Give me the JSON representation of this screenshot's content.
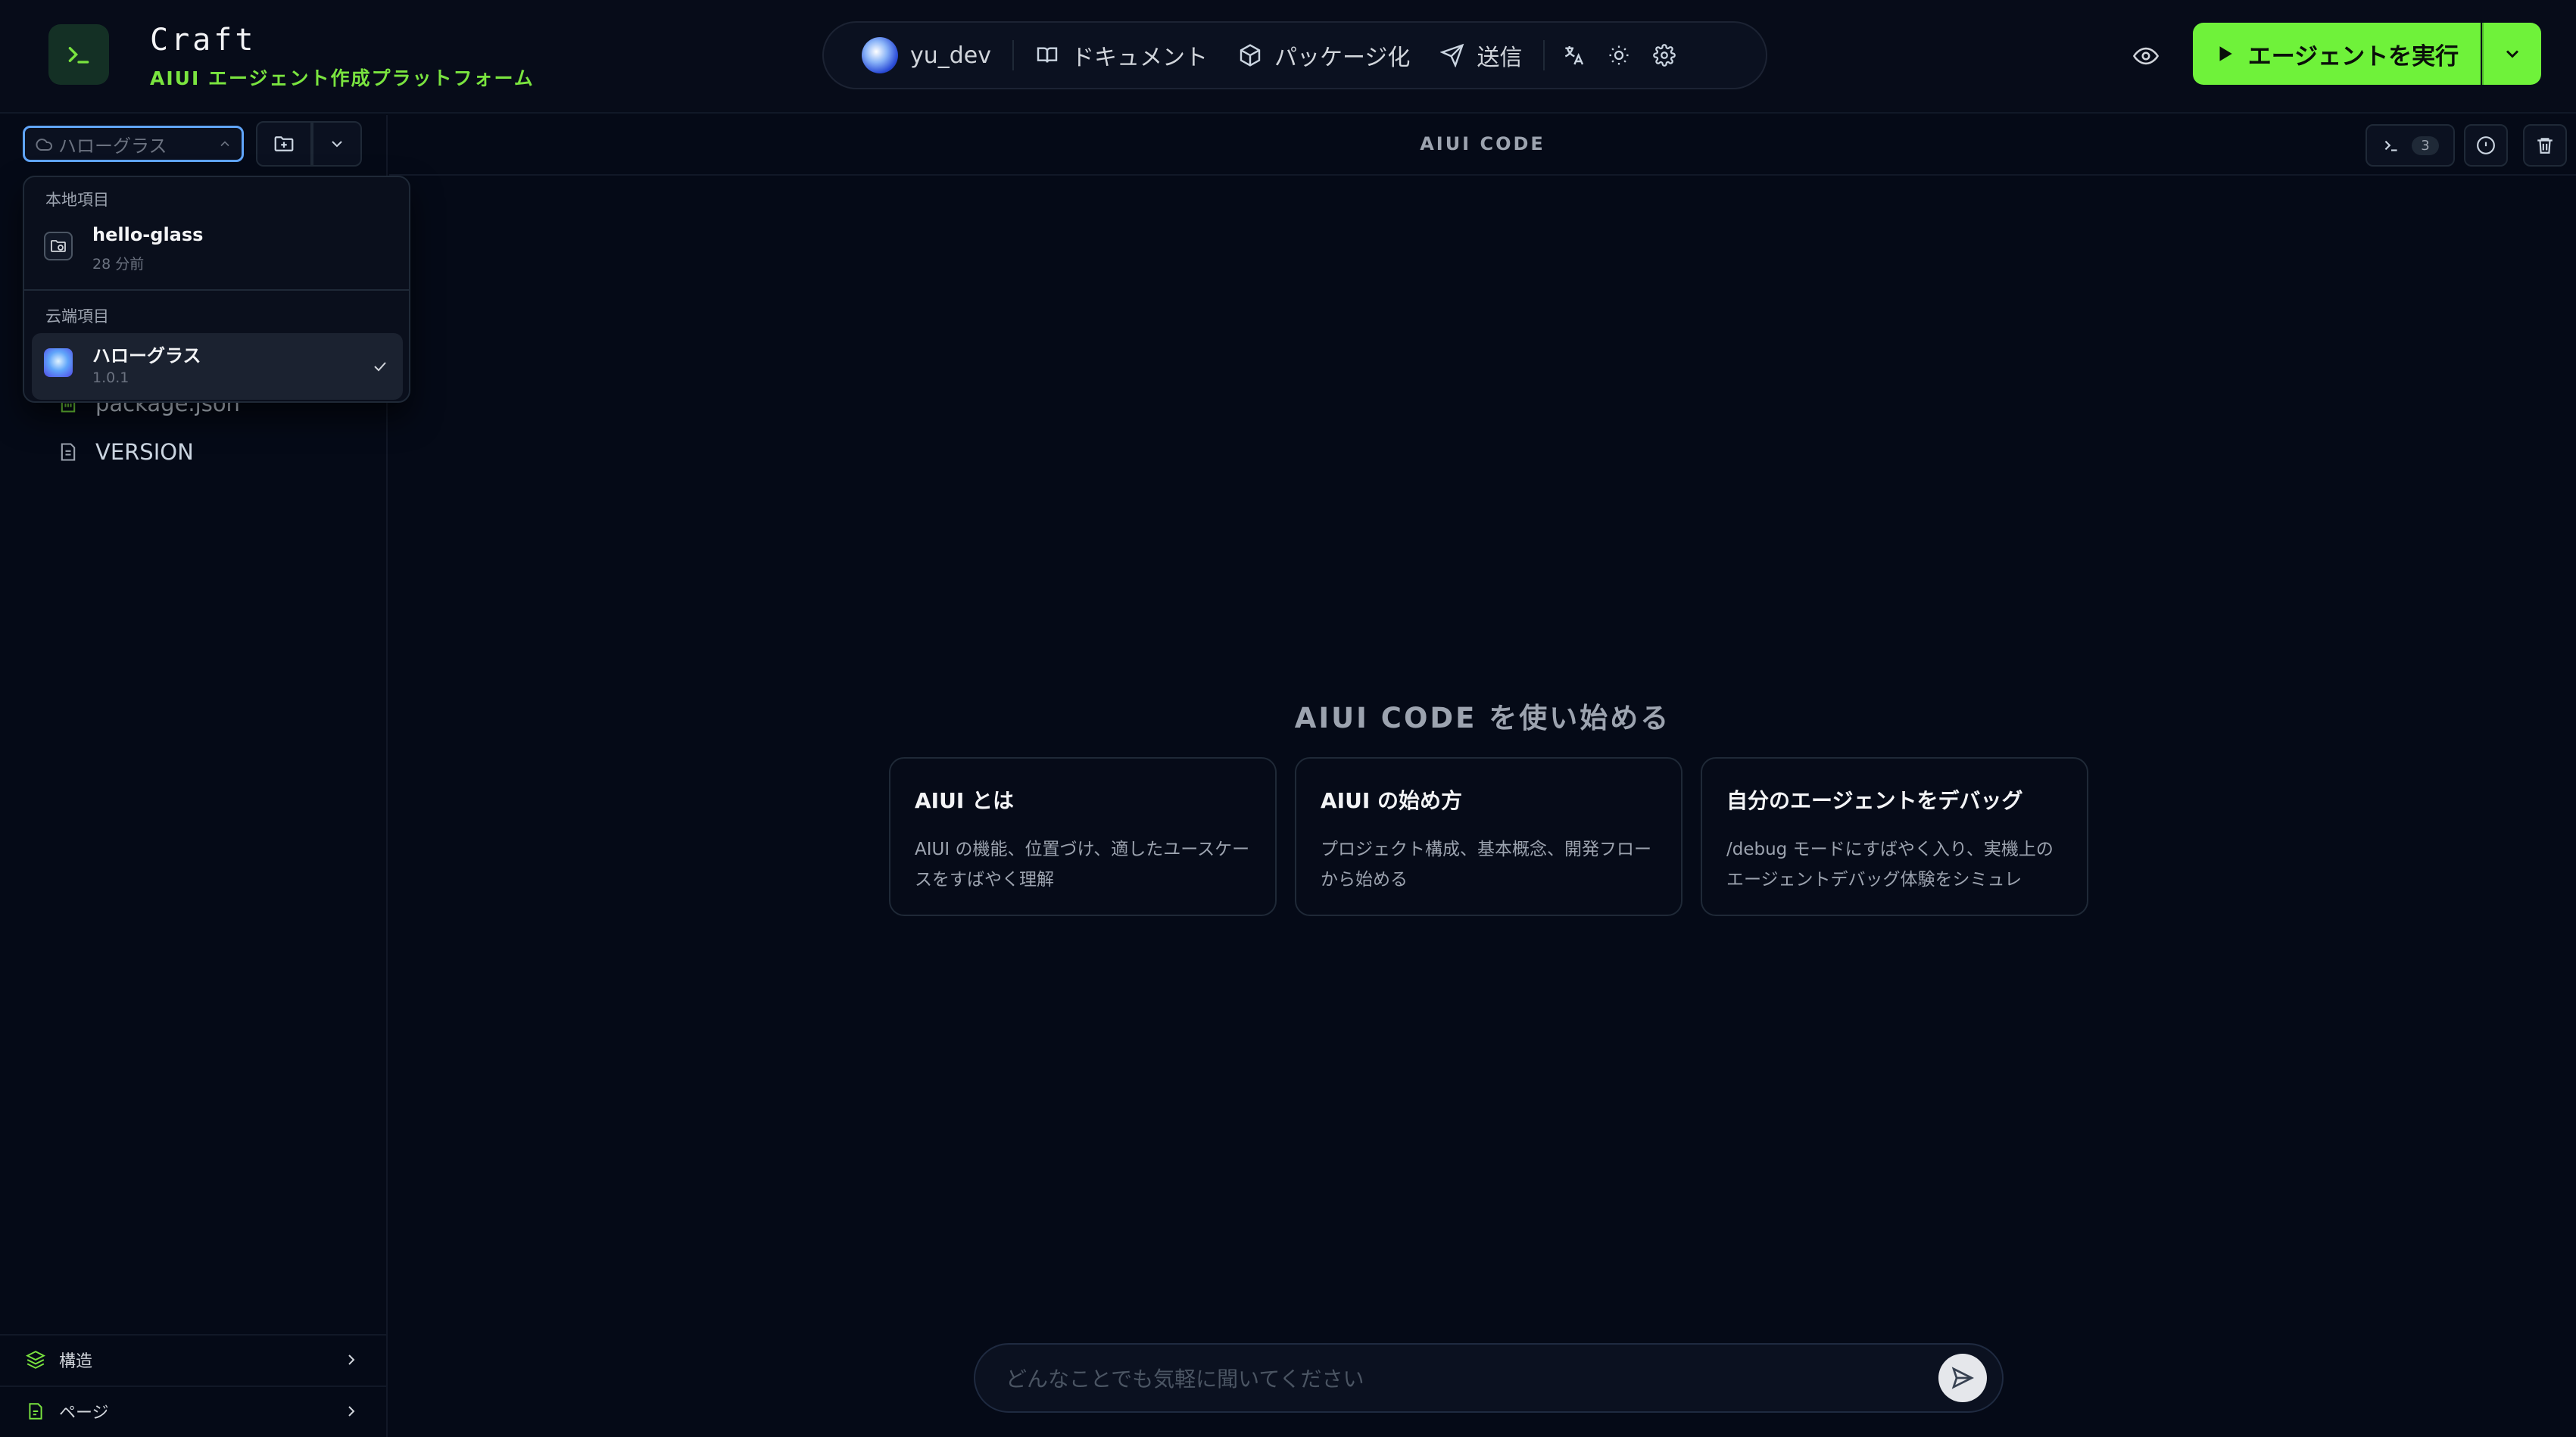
{
  "header": {
    "app_name": "Craft",
    "app_subtitle": "AIUI エージェント作成プラットフォーム",
    "user_name": "yu_dev",
    "nav": {
      "docs": "ドキュメント",
      "package": "パッケージ化",
      "send": "送信"
    },
    "run_button": "エージェントを実行"
  },
  "sidebar": {
    "project_select": "ハローグラス",
    "files": [
      {
        "name": "package.json",
        "icon": "json-file-icon"
      },
      {
        "name": "VERSION",
        "icon": "text-file-icon"
      }
    ],
    "footer": [
      {
        "label": "構造",
        "icon": "layers-icon"
      },
      {
        "label": "ページ",
        "icon": "page-file-icon"
      }
    ]
  },
  "dropdown": {
    "local_section": "本地項目",
    "local_items": [
      {
        "title": "hello-glass",
        "meta": "28 分前"
      }
    ],
    "cloud_section": "云端項目",
    "cloud_items": [
      {
        "title": "ハローグラス",
        "meta": "1.0.1",
        "selected": true
      }
    ]
  },
  "main": {
    "title": "AIUI CODE",
    "terminal_count": "3",
    "welcome": "AIUI CODE を使い始める",
    "cards": [
      {
        "title": "AIUI とは",
        "desc": "AIUI の機能、位置づけ、適したユースケースをすばやく理解"
      },
      {
        "title": "AIUI の始め方",
        "desc": "プロジェクト構成、基本概念、開発フローから始める"
      },
      {
        "title": "自分のエージェントをデバッグ",
        "desc": "/debug モードにすばやく入り、実機上のエージェントデバッグ体験をシミュレ"
      }
    ],
    "chat_placeholder": "どんなことでも気軽に聞いてください"
  },
  "colors": {
    "accent": "#6ff23a",
    "background": "#050a17",
    "focus_ring": "#60a5fa"
  }
}
